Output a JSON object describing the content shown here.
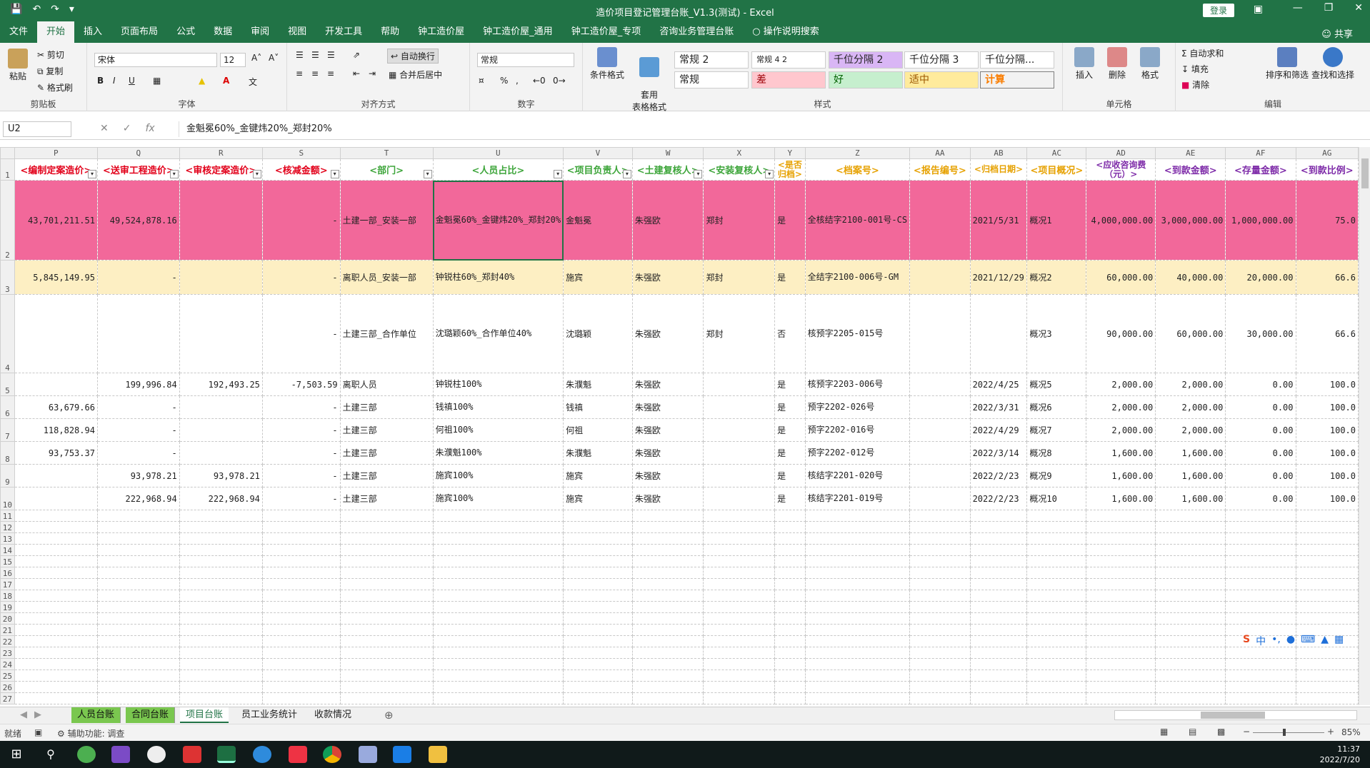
{
  "titlebar": {
    "title": "造价项目登记管理台账_V1.3(测试)  -  Excel",
    "login": "登录"
  },
  "tabs": [
    "文件",
    "开始",
    "插入",
    "页面布局",
    "公式",
    "数据",
    "审阅",
    "视图",
    "开发工具",
    "帮助",
    "钟工造价屋",
    "钟工造价屋_通用",
    "钟工造价屋_专项",
    "咨询业务管理台账",
    "操作说明搜索"
  ],
  "active_tab": "开始",
  "share": "共享",
  "ribbon": {
    "clipboard": {
      "paste": "粘贴",
      "cut": "剪切",
      "copy": "复制",
      "format_painter": "格式刷",
      "label": "剪贴板"
    },
    "font": {
      "name": "宋体",
      "size": "12",
      "bold": "B",
      "italic": "I",
      "underline": "U",
      "label": "字体"
    },
    "align": {
      "wrap": "自动换行",
      "merge": "合并后居中",
      "label": "对齐方式"
    },
    "number": {
      "format": "常规",
      "percent": "%",
      "comma": ",",
      "label": "数字"
    },
    "styles": {
      "cond_format": "条件格式",
      "table_format": "套用\n表格格式",
      "boxes": [
        "常规 2",
        "常规 4 2",
        "千位分隔 2",
        "千位分隔 3",
        "千位分隔...",
        "常规",
        "差",
        "好",
        "适中",
        "计算"
      ],
      "label": "样式"
    },
    "cells": {
      "insert": "插入",
      "delete": "删除",
      "format": "格式",
      "label": "单元格"
    },
    "editing": {
      "autosum": "自动求和",
      "fill": "填充",
      "clear": "清除",
      "sort": "排序和筛选",
      "find": "查找和选择",
      "label": "编辑"
    }
  },
  "formula_bar": {
    "name_box": "U2",
    "formula": "金魁冕60%_金键炜20%_郑封20%"
  },
  "columns": [
    "P",
    "Q",
    "R",
    "S",
    "T",
    "U",
    "V",
    "W",
    "X",
    "Y",
    "Z",
    "AA",
    "AB",
    "AC",
    "AD",
    "AE",
    "AF",
    "AG"
  ],
  "headers": [
    "<编制定案造价>",
    "<送审工程造价>",
    "<审核定案造价>",
    "<核减金额>",
    "<部门>",
    "<人员占比>",
    "<项目负责人>",
    "<土建复核人>",
    "<安装复核人>",
    "<是否归档>",
    "<档案号>",
    "<报告编号>",
    "<归档日期>",
    "<项目概况>",
    "<应收咨询费（元）>",
    "<到款金额>",
    "<存量金额>",
    "<到款比例>"
  ],
  "rows": [
    {
      "n": "2",
      "cells": [
        "43,701,211.51",
        "49,524,878.16",
        "",
        "-",
        "土建一部_安装一部",
        "金魁冕60%_金键炜20%_郑封20%",
        "金魁冕",
        "朱强欧",
        "郑封",
        "是",
        "全核结字2100-001号-CS",
        "",
        "2021/5/31",
        "概况1",
        "4,000,000.00",
        "3,000,000.00",
        "1,000,000.00",
        "75.0"
      ]
    },
    {
      "n": "3",
      "cells": [
        "5,845,149.95",
        "-",
        "",
        "-",
        "离职人员_安装一部",
        "钟锐柱60%_郑封40%",
        "施宾",
        "朱强欧",
        "郑封",
        "是",
        "全结字2100-006号-GM",
        "",
        "2021/12/29",
        "概况2",
        "60,000.00",
        "40,000.00",
        "20,000.00",
        "66.6"
      ]
    },
    {
      "n": "4",
      "cells": [
        "",
        "",
        "",
        "-",
        "土建三部_合作单位",
        "沈璐颖60%_合作单位40%",
        "沈璐颖",
        "朱强欧",
        "郑封",
        "否",
        "核预字2205-015号",
        "",
        "",
        "概况3",
        "90,000.00",
        "60,000.00",
        "30,000.00",
        "66.6"
      ]
    },
    {
      "n": "5",
      "cells": [
        "",
        "199,996.84",
        "192,493.25",
        "-7,503.59",
        "离职人员",
        "钟锐柱100%",
        "朱濮魁",
        "朱强欧",
        "",
        "是",
        "核预字2203-006号",
        "",
        "2022/4/25",
        "概况5",
        "2,000.00",
        "2,000.00",
        "0.00",
        "100.0"
      ]
    },
    {
      "n": "6",
      "cells": [
        "63,679.66",
        "-",
        "",
        "-",
        "土建三部",
        "钱禛100%",
        "钱禛",
        "朱强欧",
        "",
        "是",
        "预字2202-026号",
        "",
        "2022/3/31",
        "概况6",
        "2,000.00",
        "2,000.00",
        "0.00",
        "100.0"
      ]
    },
    {
      "n": "7",
      "cells": [
        "118,828.94",
        "-",
        "",
        "-",
        "土建三部",
        "何祖100%",
        "何祖",
        "朱强欧",
        "",
        "是",
        "预字2202-016号",
        "",
        "2022/4/29",
        "概况7",
        "2,000.00",
        "2,000.00",
        "0.00",
        "100.0"
      ]
    },
    {
      "n": "8",
      "cells": [
        "93,753.37",
        "-",
        "",
        "-",
        "土建三部",
        "朱濮魁100%",
        "朱濮魁",
        "朱强欧",
        "",
        "是",
        "预字2202-012号",
        "",
        "2022/3/14",
        "概况8",
        "1,600.00",
        "1,600.00",
        "0.00",
        "100.0"
      ]
    },
    {
      "n": "9",
      "cells": [
        "",
        "93,978.21",
        "93,978.21",
        "-",
        "土建三部",
        "施宾100%",
        "施宾",
        "朱强欧",
        "",
        "是",
        "核结字2201-020号",
        "",
        "2022/2/23",
        "概况9",
        "1,600.00",
        "1,600.00",
        "0.00",
        "100.0"
      ]
    },
    {
      "n": "10",
      "cells": [
        "",
        "222,968.94",
        "222,968.94",
        "-",
        "土建三部",
        "施宾100%",
        "施宾",
        "朱强欧",
        "",
        "是",
        "核结字2201-019号",
        "",
        "2022/2/23",
        "概况10",
        "1,600.00",
        "1,600.00",
        "0.00",
        "100.0"
      ]
    }
  ],
  "empty_rows": [
    "11",
    "12",
    "13",
    "14",
    "15",
    "16",
    "17",
    "18",
    "19",
    "20",
    "21",
    "22",
    "23",
    "24",
    "25",
    "26",
    "27"
  ],
  "sheet_tabs": [
    "人员台账",
    "合同台账",
    "项目台账",
    "员工业务统计",
    "收款情况"
  ],
  "active_sheet": "项目台账",
  "status": {
    "ready": "就绪",
    "accessibility": "辅助功能: 调查",
    "zoom": "85%"
  },
  "taskbar": {
    "time": "11:37",
    "date": "2022/7/20"
  },
  "colors": {
    "excel_green": "#217346",
    "pink_row": "#f2689a",
    "cream_row": "#fdefc3",
    "header_red": "#e2001a",
    "header_green": "#3da53a",
    "header_purple": "#7d2aa8"
  }
}
